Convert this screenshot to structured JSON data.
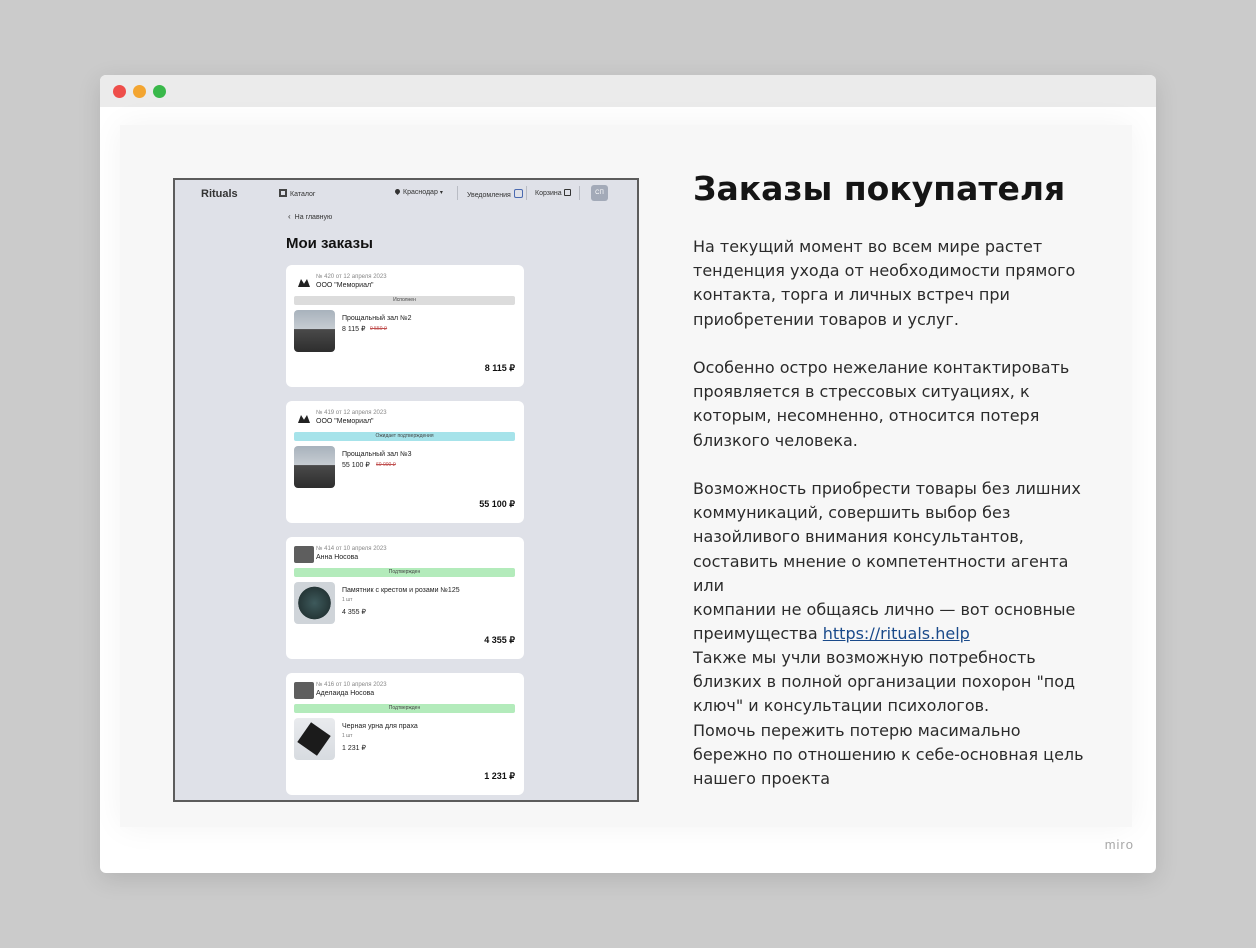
{
  "window": {
    "controls": [
      "close",
      "minimize",
      "maximize"
    ]
  },
  "shot": {
    "nav": {
      "logo": "Rituals",
      "catalog": "Каталог",
      "city": "Краснодар",
      "notifications": "Уведомления",
      "cart": "Корзина",
      "avatar": "СП"
    },
    "back": "На главную",
    "title": "Мои заказы",
    "orders": [
      {
        "num": "№ 420 от 12 апреля 2023",
        "seller": "ООО \"Мемориал\"",
        "status": "Исполнен",
        "item": "Прощальный зал №2",
        "qty": "",
        "price": "8 115 ₽",
        "old_price": "9 550 ₽",
        "total": "8 115 ₽"
      },
      {
        "num": "№ 419 от 12 апреля 2023",
        "seller": "ООО \"Мемориал\"",
        "status": "Ожидает подтверждения",
        "item": "Прощальный зал №3",
        "qty": "",
        "price": "55 100 ₽",
        "old_price": "60 000 ₽",
        "total": "55 100 ₽"
      },
      {
        "num": "№ 414 от 10 апреля 2023",
        "seller": "Анна Носова",
        "status": "Подтвержден",
        "item": "Памятник с крестом и розами №125",
        "qty": "1 шт",
        "price": "4 355 ₽",
        "old_price": "",
        "total": "4 355 ₽"
      },
      {
        "num": "№ 416 от 10 апреля 2023",
        "seller": "Аделаида Носова",
        "status": "Подтвержден",
        "item": "Черная урна для праха",
        "qty": "1 шт",
        "price": "1 231 ₽",
        "old_price": "",
        "total": "1 231 ₽"
      }
    ],
    "status_colors": {
      "done": "#dcdcdc",
      "pending": "#a6e3ea",
      "confirmed": "#b3ebbb"
    }
  },
  "heading": "Заказы покупателя",
  "paragraphs": {
    "p1": "На текущий момент во всем мире растет\nтенденция ухода от необходимости прямого\nконтакта, торга и личных встреч при\nприобретении товаров и услуг.",
    "p2": "Особенно остро нежелание контактировать\nпроявляется в стрессовых ситуациях, к\nкоторым, несомненно, относится потеря\nблизкого человека.",
    "p3": "Возможность приобрести товары без лишних\nкоммуникаций, совершить выбор без\nназойливого внимания консультантов,\nсоставить мнение о компетентности агента или\nкомпании не общаясь лично — вот основные\nпреимущества  ",
    "link": "https://rituals.help",
    "p4": "Также мы учли возможную потребность\nблизких в полной организации похорон \"под\nключ\" и консультации психологов.\nПомочь пережить потерю масимально\nбережно по отношению к себе-основная цель\nнашего проекта"
  },
  "brand": "miro",
  "colors": {
    "window_bg": "#ffffff",
    "backdrop": "#cbcbcb",
    "shot_bg": "#dfe1e8",
    "link": "#1a4a8a"
  }
}
